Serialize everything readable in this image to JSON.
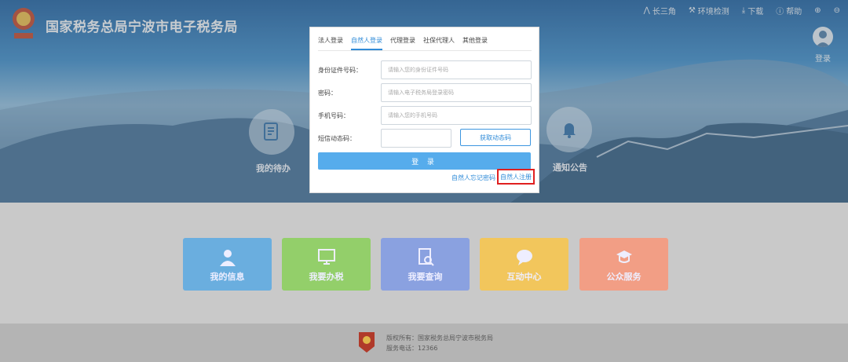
{
  "header": {
    "title": "国家税务总局宁波市电子税务局",
    "toolbar": [
      {
        "icon": "triangle-nodes-icon",
        "label": "长三角"
      },
      {
        "icon": "wrench-icon",
        "label": "环境检测"
      },
      {
        "icon": "download-icon",
        "label": "下载"
      },
      {
        "icon": "help-icon",
        "label": "帮助"
      }
    ],
    "login_label": "登录"
  },
  "hero": {
    "todo_label": "我的待办",
    "notice_label": "通知公告"
  },
  "tiles": [
    {
      "label": "我的信息",
      "color": "#6aaedf"
    },
    {
      "label": "我要办税",
      "color": "#93cf6a"
    },
    {
      "label": "我要查询",
      "color": "#8aa1e0"
    },
    {
      "label": "互动中心",
      "color": "#f2c65c"
    },
    {
      "label": "公众服务",
      "color": "#f29e85"
    }
  ],
  "modal": {
    "tabs": [
      "法人登录",
      "自然人登录",
      "代理登录",
      "社保代理人",
      "其他登录"
    ],
    "active_tab": 1,
    "id_label": "身份证件号码：",
    "id_placeholder": "请输入您的身份证件号码",
    "pwd_label": "密码：",
    "pwd_placeholder": "请输入电子税务局登录密码",
    "phone_label": "手机号码：",
    "phone_placeholder": "请输入您的手机号码",
    "sms_label": "短信动态码：",
    "sms_value": "",
    "get_code": "获取动态码",
    "submit": "登 录",
    "forgot": "自然人忘记密码",
    "register": "自然人注册"
  },
  "footer": {
    "copyright": "版权所有：国家税务总局宁波市税务局",
    "phone": "服务电话：12366"
  },
  "colors": {
    "accent": "#2f8bd8",
    "highlight": "#e02020"
  }
}
